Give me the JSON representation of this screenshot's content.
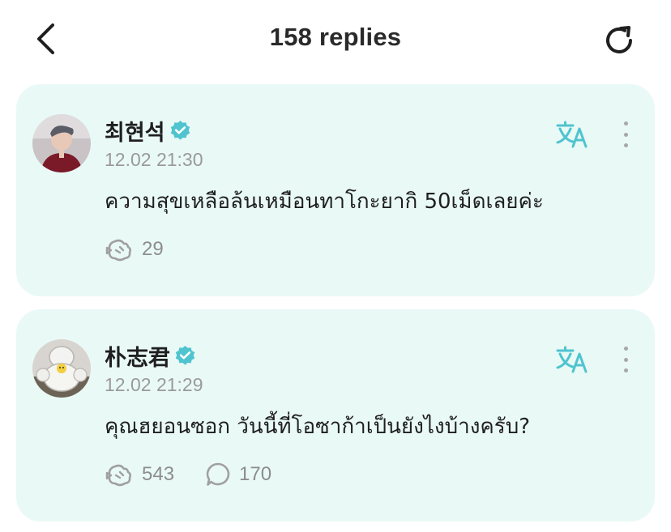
{
  "header": {
    "title": "158 replies"
  },
  "replies": [
    {
      "author": "최현석",
      "timestamp": "12.02 21:30",
      "text": "ความสุขเหลือล้นเหมือนทาโกะยากิ 50เม็ดเลยค่ะ",
      "reactions": "29"
    },
    {
      "author": "朴志君",
      "timestamp": "12.02 21:29",
      "text": "คุณฮยอนซอก วันนี้ที่โอซาก้าเป็นยังไงบ้างครับ?",
      "reactions": "543",
      "comments": "170"
    }
  ],
  "colors": {
    "card_background": "#e9f9f6",
    "accent": "#4fc4cf",
    "muted_text": "#9a9a9a"
  },
  "icons": {
    "back": "chevron-left-icon",
    "refresh": "refresh-icon",
    "verified": "verified-badge-icon",
    "translate": "translate-icon",
    "more": "more-vertical-icon",
    "reaction": "reaction-icon",
    "comment": "comment-bubble-icon"
  }
}
